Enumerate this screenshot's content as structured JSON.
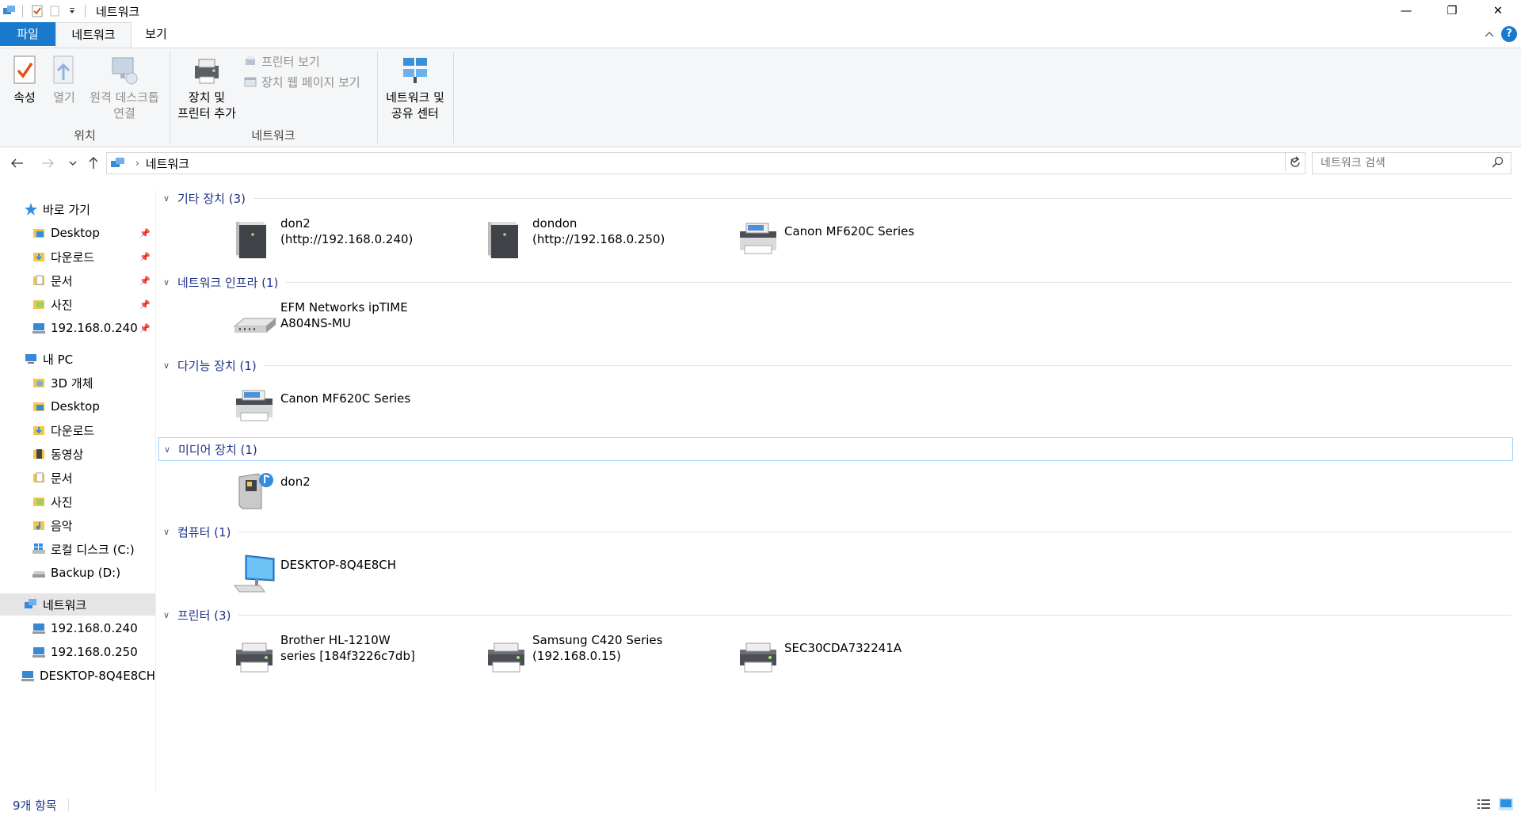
{
  "window": {
    "title": "네트워크",
    "controls": {
      "minimize": "—",
      "restore": "❐",
      "close": "✕"
    }
  },
  "ribbon_tabs": {
    "file": "파일",
    "network": "네트워크",
    "view": "보기",
    "help": "?"
  },
  "ribbon": {
    "properties": "속성",
    "open": "열기",
    "remote_desktop_line1": "원격 데스크톱",
    "remote_desktop_line2": "연결",
    "group_location": "위치",
    "add_devices_line1": "장치 및",
    "add_devices_line2": "프린터 추가",
    "view_printer": "프린터 보기",
    "view_device_webpage": "장치 웹 페이지 보기",
    "group_network": "네트워크",
    "network_center_line1": "네트워크 및",
    "network_center_line2": "공유 센터"
  },
  "address": {
    "crumb": "네트워크",
    "search_placeholder": "네트워크 검색"
  },
  "nav": {
    "quick_access": "바로 가기",
    "qa_desktop": "Desktop",
    "qa_downloads": "다운로드",
    "qa_documents": "문서",
    "qa_pictures": "사진",
    "qa_ip240": "192.168.0.240",
    "this_pc": "내 PC",
    "pc_3d": "3D 개체",
    "pc_desktop": "Desktop",
    "pc_downloads": "다운로드",
    "pc_videos": "동영상",
    "pc_documents": "문서",
    "pc_pictures": "사진",
    "pc_music": "음악",
    "pc_local_c": "로컬 디스크 (C:)",
    "pc_backup_d": "Backup (D:)",
    "network": "네트워크",
    "net_240": "192.168.0.240",
    "net_250": "192.168.0.250",
    "net_desktop": "DESKTOP-8Q4E8CH"
  },
  "groups": {
    "other": "기타 장치 (3)",
    "infra": "네트워크 인프라 (1)",
    "mfp": "다기능 장치 (1)",
    "media": "미디어 장치 (1)",
    "computer": "컴퓨터 (1)",
    "printer": "프린터 (3)"
  },
  "devices": {
    "other_1_l1": "don2",
    "other_1_l2": "(http://192.168.0.240)",
    "other_2_l1": "dondon",
    "other_2_l2": "(http://192.168.0.250)",
    "other_3": "Canon MF620C Series",
    "infra_1_l1": "EFM Networks ipTIME",
    "infra_1_l2": "A804NS-MU",
    "mfp_1": "Canon MF620C Series",
    "media_1": "don2",
    "computer_1": "DESKTOP-8Q4E8CH",
    "printer_1_l1": "Brother HL-1210W",
    "printer_1_l2": "series [184f3226c7db]",
    "printer_2_l1": "Samsung C420 Series",
    "printer_2_l2": "(192.168.0.15)",
    "printer_3": "SEC30CDA732241A"
  },
  "status": {
    "item_count": "9개 항목"
  },
  "colors": {
    "accent": "#1979ca",
    "group_header": "#1e3287",
    "selection": "#e5e5e5"
  }
}
